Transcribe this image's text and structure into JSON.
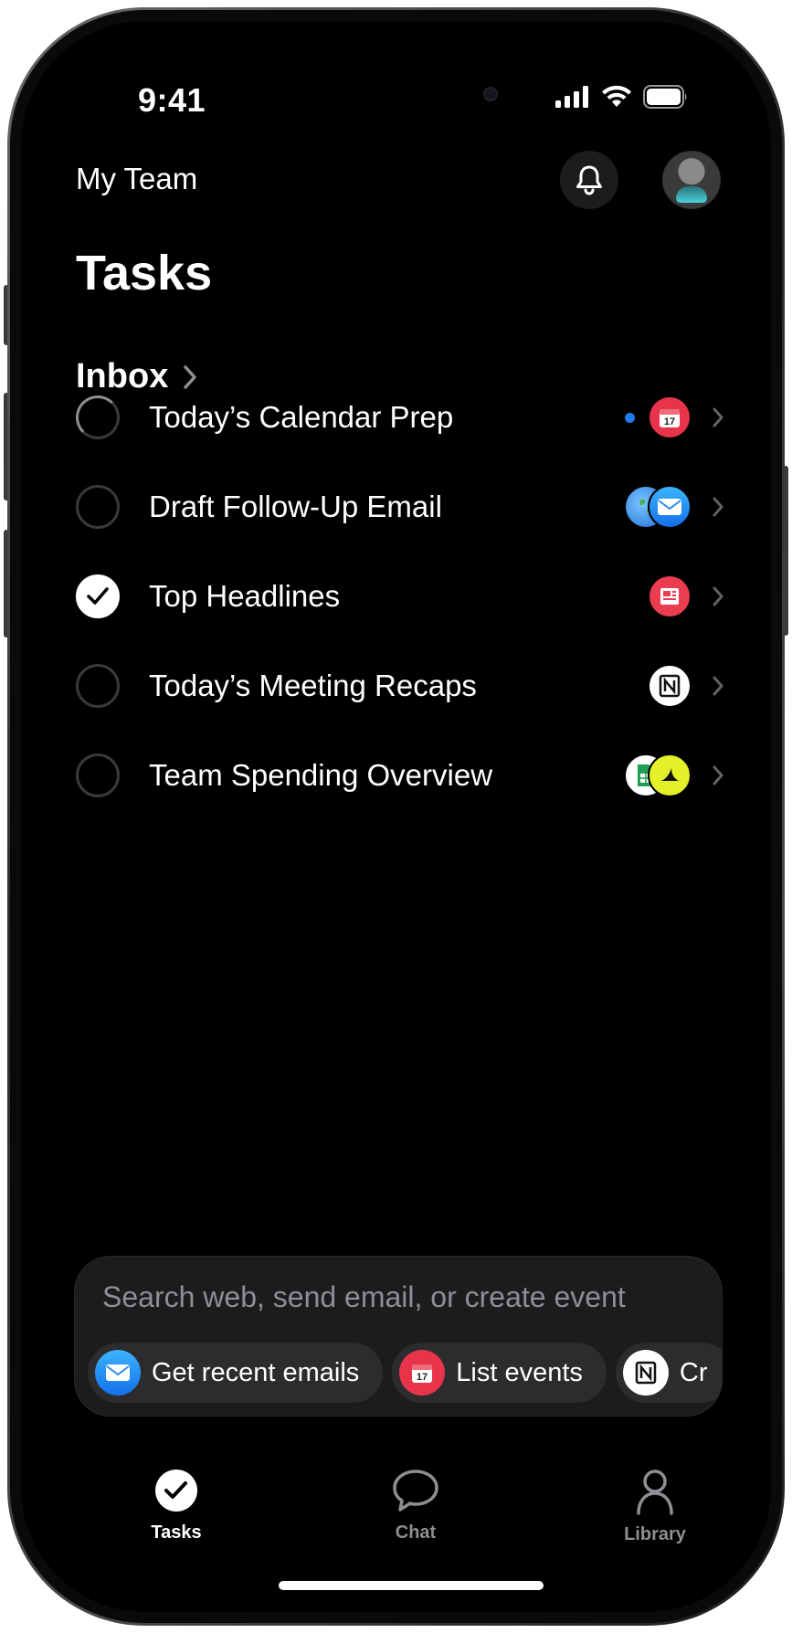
{
  "status_bar": {
    "time": "9:41"
  },
  "header": {
    "team_label": "My Team",
    "title": "Tasks"
  },
  "inbox": {
    "label": "Inbox"
  },
  "tasks": [
    {
      "title": "Today’s Calendar Prep",
      "state": "in-progress",
      "unread": true,
      "apps": [
        "calendar-icon"
      ]
    },
    {
      "title": "Draft Follow-Up Email",
      "state": "pending",
      "unread": false,
      "apps": [
        "globe-icon",
        "mail-icon"
      ]
    },
    {
      "title": "Top Headlines",
      "state": "done",
      "unread": false,
      "apps": [
        "news-icon"
      ]
    },
    {
      "title": "Today’s Meeting Recaps",
      "state": "pending",
      "unread": false,
      "apps": [
        "notion-icon"
      ]
    },
    {
      "title": "Team Spending Overview",
      "state": "pending",
      "unread": false,
      "apps": [
        "sheets-icon",
        "expense-icon"
      ]
    }
  ],
  "composer": {
    "placeholder": "Search web, send email, or create event",
    "chips": [
      {
        "label": "Get recent emails",
        "icon": "mail-icon"
      },
      {
        "label": "List events",
        "icon": "calendar-icon"
      },
      {
        "label": "Cr",
        "icon": "notion-icon"
      }
    ]
  },
  "tab_bar": {
    "tabs": [
      {
        "label": "Tasks",
        "icon": "check-circle-icon",
        "active": true
      },
      {
        "label": "Chat",
        "icon": "chat-bubble-icon",
        "active": false
      },
      {
        "label": "Library",
        "icon": "person-icon",
        "active": false
      }
    ]
  },
  "colors": {
    "accent_blue": "#1e7cf0",
    "background": "#000000",
    "inactive": "#8e8e93"
  }
}
